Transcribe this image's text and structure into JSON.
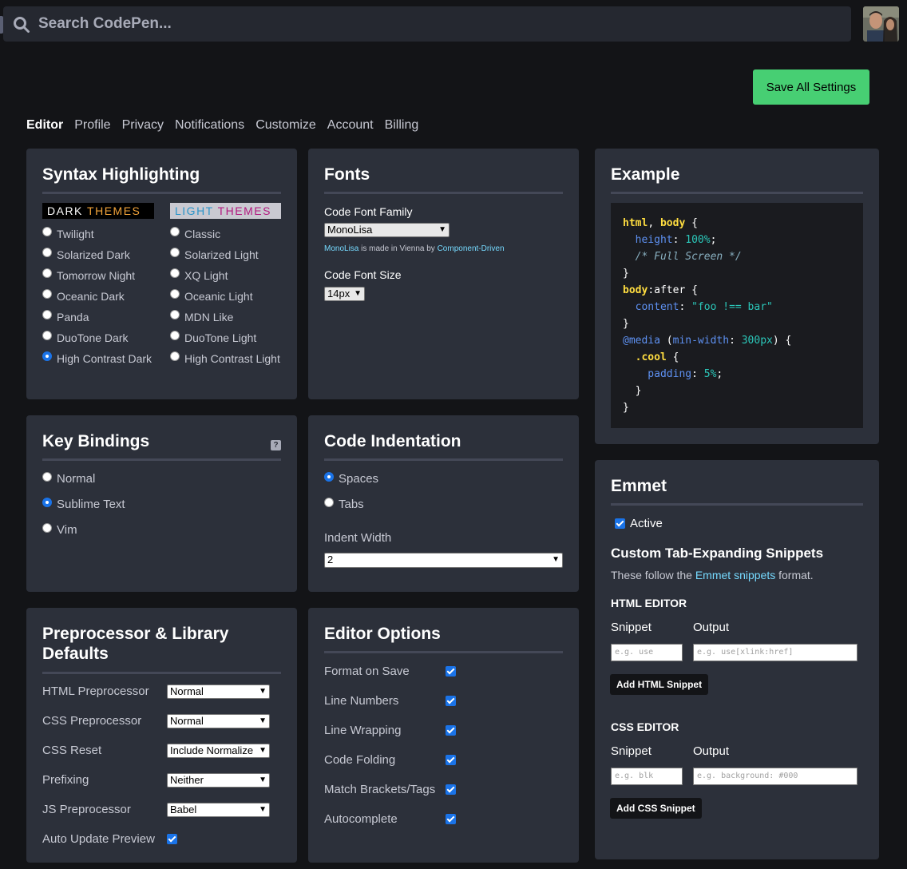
{
  "search": {
    "placeholder": "Search CodePen..."
  },
  "header": {
    "save_label": "Save All Settings"
  },
  "tabs": [
    "Editor",
    "Profile",
    "Privacy",
    "Notifications",
    "Customize",
    "Account",
    "Billing"
  ],
  "syntax": {
    "title": "Syntax Highlighting",
    "dark_header": [
      "DARK ",
      "THEMES"
    ],
    "light_header": [
      "LIGHT ",
      "THEMES"
    ],
    "dark": [
      "Twilight",
      "Solarized Dark",
      "Tomorrow Night",
      "Oceanic Dark",
      "Panda",
      "DuoTone Dark",
      "High Contrast Dark"
    ],
    "light": [
      "Classic",
      "Solarized Light",
      "XQ Light",
      "Oceanic Light",
      "MDN Like",
      "DuoTone Light",
      "High Contrast Light"
    ],
    "selected": "High Contrast Dark"
  },
  "fonts": {
    "title": "Fonts",
    "family_label": "Code Font Family",
    "family_value": "MonoLisa",
    "credit": [
      "MonoLisa",
      " is made in Vienna by ",
      "Component-Driven"
    ],
    "size_label": "Code Font Size",
    "size_value": "14px"
  },
  "example": {
    "title": "Example"
  },
  "keys": {
    "title": "Key Bindings",
    "options": [
      "Normal",
      "Sublime Text",
      "Vim"
    ],
    "selected": "Sublime Text"
  },
  "indent": {
    "title": "Code Indentation",
    "options": [
      "Spaces",
      "Tabs"
    ],
    "selected": "Spaces",
    "width_label": "Indent Width",
    "width_value": "2"
  },
  "emmet": {
    "title": "Emmet",
    "active_label": "Active",
    "snippets_title": "Custom Tab-Expanding Snippets",
    "desc": [
      "These follow the ",
      "Emmet snippets",
      " format."
    ],
    "html_title": "HTML EDITOR",
    "css_title": "CSS EDITOR",
    "snippet_label": "Snippet",
    "output_label": "Output",
    "html_snippet_ph": "e.g. use",
    "html_output_ph": "e.g. use[xlink:href]",
    "html_button": "Add HTML Snippet",
    "css_snippet_ph": "e.g. blk",
    "css_output_ph": "e.g. background: #000",
    "css_button": "Add CSS Snippet"
  },
  "prepro": {
    "title": "Preprocessor & Library Defaults",
    "rows": [
      {
        "label": "HTML Preprocessor",
        "value": "Normal"
      },
      {
        "label": "CSS Preprocessor",
        "value": "Normal"
      },
      {
        "label": "CSS Reset",
        "value": "Include Normalize"
      },
      {
        "label": "Prefixing",
        "value": "Neither"
      },
      {
        "label": "JS Preprocessor",
        "value": "Babel"
      }
    ],
    "auto_label": "Auto Update Preview"
  },
  "options": {
    "title": "Editor Options",
    "items": [
      "Format on Save",
      "Line Numbers",
      "Line Wrapping",
      "Code Folding",
      "Match Brackets/Tags",
      "Autocomplete"
    ]
  }
}
